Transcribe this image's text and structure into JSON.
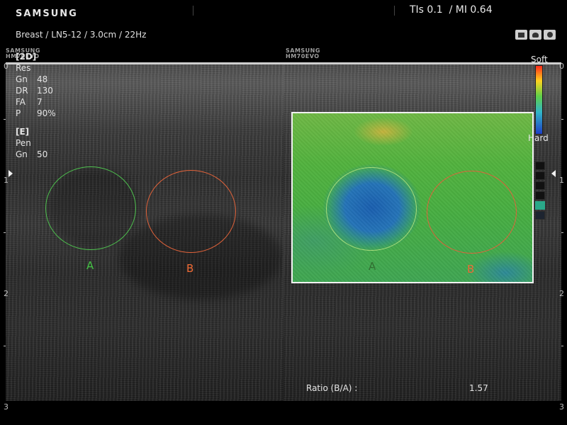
{
  "header": {
    "brand": "SAMSUNG",
    "tis": "TIs 0.1",
    "mi": "  / MI 0.64",
    "probe_info": "Breast / LN5-12 / 3.0cm / 22Hz",
    "tool_icons": [
      "probe-icon",
      "scan-mode-icon",
      "settings-icon"
    ]
  },
  "watermark": {
    "brand": "SAMSUNG",
    "model": "HM70EVO"
  },
  "params": {
    "mode_2d": "[2D]",
    "res": "Res",
    "gn_label": "Gn",
    "gn_value": "48",
    "dr_label": "DR",
    "dr_value": "130",
    "fa_label": "FA",
    "fa_value": "7",
    "p_label": "P",
    "p_value": "90%",
    "mode_e": "[E]",
    "pen": "Pen",
    "egn_label": "Gn",
    "egn_value": "50"
  },
  "scale": {
    "depth_ticks": [
      "0",
      "1",
      "2",
      "3"
    ],
    "soft_label": "Soft",
    "hard_label": "Hard",
    "colors": [
      "#ff2a1a",
      "#ffd21f",
      "#5ed14a",
      "#32b6c8",
      "#1e40c8"
    ],
    "pressure_level_fraction": 0.67
  },
  "regions": {
    "a_label": "A",
    "b_label": "B",
    "a_color": "#4ec24e",
    "b_color": "#e2633a"
  },
  "ratio": {
    "label": "Ratio (B/A) :",
    "value": "1.57"
  }
}
